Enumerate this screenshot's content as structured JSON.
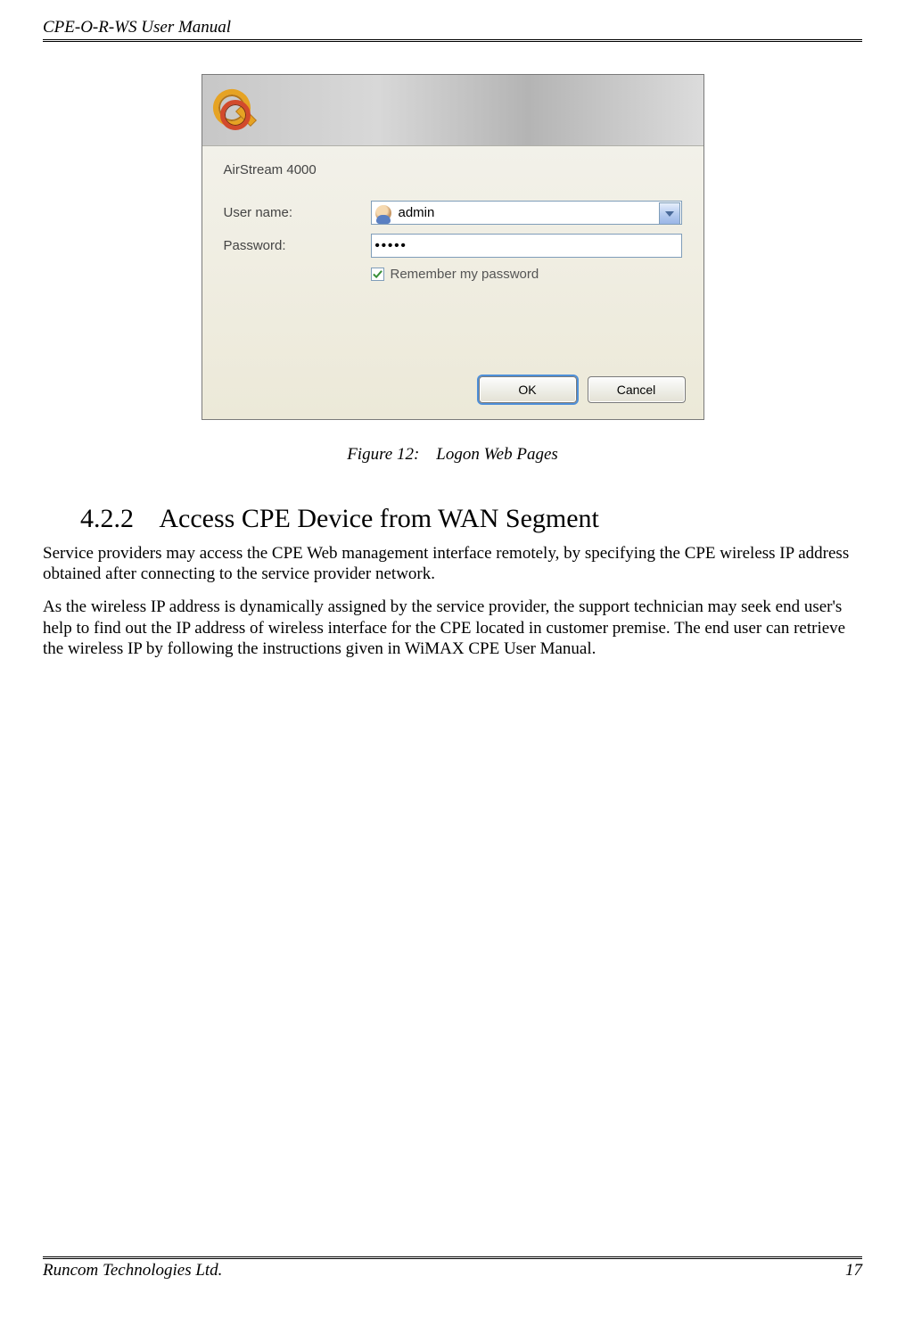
{
  "header": {
    "title": "CPE-O-R-WS User Manual"
  },
  "dialog": {
    "site": "AirStream 4000",
    "username_label": "User name:",
    "username_value": "admin",
    "password_label": "Password:",
    "password_value": "•••••",
    "remember_label": "Remember my password",
    "remember_checked": true,
    "ok_label": "OK",
    "cancel_label": "Cancel"
  },
  "figure": {
    "label": "Figure 12:",
    "title": "Logon Web Pages"
  },
  "section": {
    "number": "4.2.2",
    "title": "Access CPE Device from WAN Segment"
  },
  "paragraph1": "Service providers may access the CPE Web management interface remotely, by specifying the CPE wireless IP address obtained after connecting to the service provider network.",
  "paragraph2": "As the wireless IP address is dynamically assigned by the service provider, the support technician may seek end user's help to find out the IP address of wireless interface for the CPE located in customer premise. The end user can retrieve the wireless IP by following the instructions given in WiMAX CPE User Manual.",
  "footer": {
    "company": "Runcom Technologies Ltd.",
    "page": "17"
  }
}
